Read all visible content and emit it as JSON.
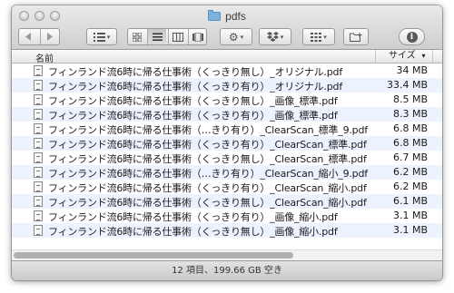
{
  "window": {
    "title": "pdfs",
    "title_icon": "folder-icon"
  },
  "toolbar": {
    "back_icon": "back-arrow-icon",
    "forward_icon": "forward-arrow-icon",
    "arrange_icon": "list-arrange-icon",
    "view_icons": [
      "icon-view-icon",
      "list-view-icon",
      "column-view-icon",
      "coverflow-view-icon"
    ],
    "active_view": "list-view-icon",
    "action_icon": "gear-icon",
    "share_icon": "dropbox-icon",
    "quicklook_icon": "quicklook-icon",
    "newfolder_icon": "new-folder-icon",
    "info_glyph": "i"
  },
  "columns": {
    "name": "名前",
    "size": "サイズ",
    "sort_indicator": "▾"
  },
  "files": [
    {
      "name": "フィンランド流6時に帰る仕事術（くっきり無し）_オリジナル.pdf",
      "size": "34 MB"
    },
    {
      "name": "フィンランド流6時に帰る仕事術（くっきり有り）_オリジナル.pdf",
      "size": "33.4 MB"
    },
    {
      "name": "フィンランド流6時に帰る仕事術（くっきり無し）_画像_標準.pdf",
      "size": "8.5 MB"
    },
    {
      "name": "フィンランド流6時に帰る仕事術（くっきり有り）_画像_標準.pdf",
      "size": "8.3 MB"
    },
    {
      "name": "フィンランド流6時に帰る仕事術（…きり有り）_ClearScan_標準_9.pdf",
      "size": "6.8 MB"
    },
    {
      "name": "フィンランド流6時に帰る仕事術（くっきり有り）_ClearScan_標準.pdf",
      "size": "6.8 MB"
    },
    {
      "name": "フィンランド流6時に帰る仕事術（くっきり無し）_ClearScan_標準.pdf",
      "size": "6.7 MB"
    },
    {
      "name": "フィンランド流6時に帰る仕事術（…きり有り）_ClearScan_縮小_9.pdf",
      "size": "6.2 MB"
    },
    {
      "name": "フィンランド流6時に帰る仕事術（くっきり有り）_ClearScan_縮小.pdf",
      "size": "6.2 MB"
    },
    {
      "name": "フィンランド流6時に帰る仕事術（くっきり無し）_ClearScan_縮小.pdf",
      "size": "6.1 MB"
    },
    {
      "name": "フィンランド流6時に帰る仕事術（くっきり有り）_画像_縮小.pdf",
      "size": "3.1 MB"
    },
    {
      "name": "フィンランド流6時に帰る仕事術（くっきり無し）_画像_縮小.pdf",
      "size": "3.1 MB"
    }
  ],
  "status": {
    "text": "12 項目、199.66 GB 空き"
  },
  "colors": {
    "row_alt": "#edf3fe",
    "folder": "#7fb1dd"
  }
}
